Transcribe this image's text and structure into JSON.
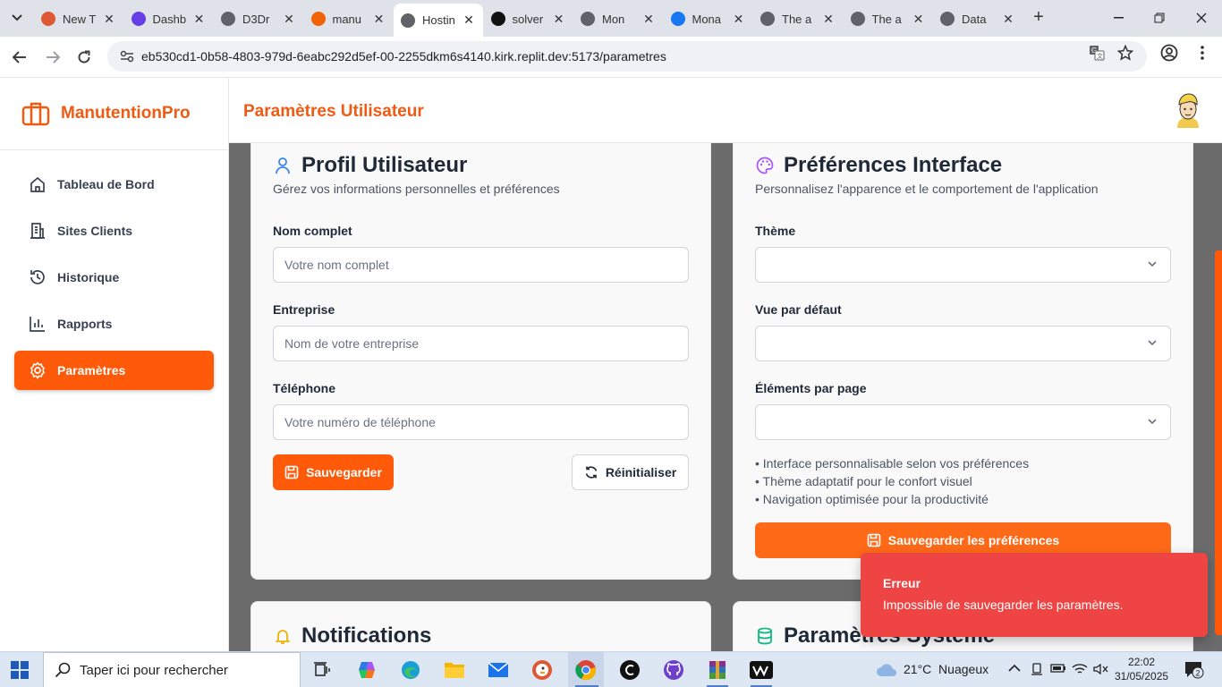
{
  "browser": {
    "tabs": [
      {
        "title": "New T",
        "favicon": "duckduckgo-icon",
        "color": "#de5833",
        "active": false
      },
      {
        "title": "Dashb",
        "favicon": "hostinger-icon",
        "color": "#673de6",
        "active": false
      },
      {
        "title": "D3Dr",
        "favicon": "globe-icon",
        "color": "#5f6368",
        "active": false
      },
      {
        "title": "manu",
        "favicon": "replit-icon",
        "color": "#f26207",
        "active": false
      },
      {
        "title": "Hostin",
        "favicon": "globe-icon",
        "color": "#5f6368",
        "active": true
      },
      {
        "title": "solver",
        "favicon": "solver-icon",
        "color": "#111111",
        "active": false
      },
      {
        "title": "Mon",
        "favicon": "loading-icon",
        "color": "#5f6368",
        "active": false
      },
      {
        "title": "Mona",
        "favicon": "facebook-icon",
        "color": "#1877f2",
        "active": false
      },
      {
        "title": "The a",
        "favicon": "globe-icon",
        "color": "#5f6368",
        "active": false
      },
      {
        "title": "The a",
        "favicon": "globe-icon",
        "color": "#5f6368",
        "active": false
      },
      {
        "title": "Data",
        "favicon": "globe-icon",
        "color": "#5f6368",
        "active": false
      }
    ],
    "url": "eb530cd1-0b58-4803-979d-6eabc292d5ef-00-2255dkm6s4140.kirk.replit.dev:5173/parametres"
  },
  "app": {
    "brand": "ManutentionPro",
    "brand_color": "#f05a12",
    "accent": "#ff5a0a",
    "page_title": "Paramètres Utilisateur",
    "nav": [
      {
        "label": "Tableau de Bord",
        "icon": "home-icon",
        "active": false
      },
      {
        "label": "Sites Clients",
        "icon": "building-icon",
        "active": false
      },
      {
        "label": "Historique",
        "icon": "history-icon",
        "active": false
      },
      {
        "label": "Rapports",
        "icon": "bar-chart-icon",
        "active": false
      },
      {
        "label": "Paramètres",
        "icon": "gear-icon",
        "active": true
      }
    ]
  },
  "profile": {
    "title": "Profil Utilisateur",
    "description": "Gérez vos informations personnelles et préférences",
    "name_label": "Nom complet",
    "name_placeholder": "Votre nom complet",
    "company_label": "Entreprise",
    "company_placeholder": "Nom de votre entreprise",
    "phone_label": "Téléphone",
    "phone_placeholder": "Votre numéro de téléphone",
    "save_label": "Sauvegarder",
    "reset_label": "Réinitialiser"
  },
  "preferences": {
    "title": "Préférences Interface",
    "description": "Personnalisez l'apparence et le comportement de l'application",
    "theme_label": "Thème",
    "theme_value": "",
    "default_view_label": "Vue par défaut",
    "default_view_value": "",
    "items_per_page_label": "Éléments par page",
    "items_per_page_value": "",
    "bullets": [
      "• Interface personnalisable selon vos préférences",
      "• Thème adaptatif pour le confort visuel",
      "• Navigation optimisée pour la productivité"
    ],
    "save_label": "Sauvegarder les préférences"
  },
  "notifications": {
    "title": "Notifications"
  },
  "system": {
    "title": "Paramètres Système"
  },
  "toast": {
    "title": "Erreur",
    "message": "Impossible de sauvegarder les paramètres.",
    "color": "#ef4444"
  },
  "taskbar": {
    "search_placeholder": "Taper ici pour rechercher",
    "weather": "21°C  Nuageux",
    "time": "22:02",
    "date": "31/05/2025",
    "notification_count": "2"
  }
}
